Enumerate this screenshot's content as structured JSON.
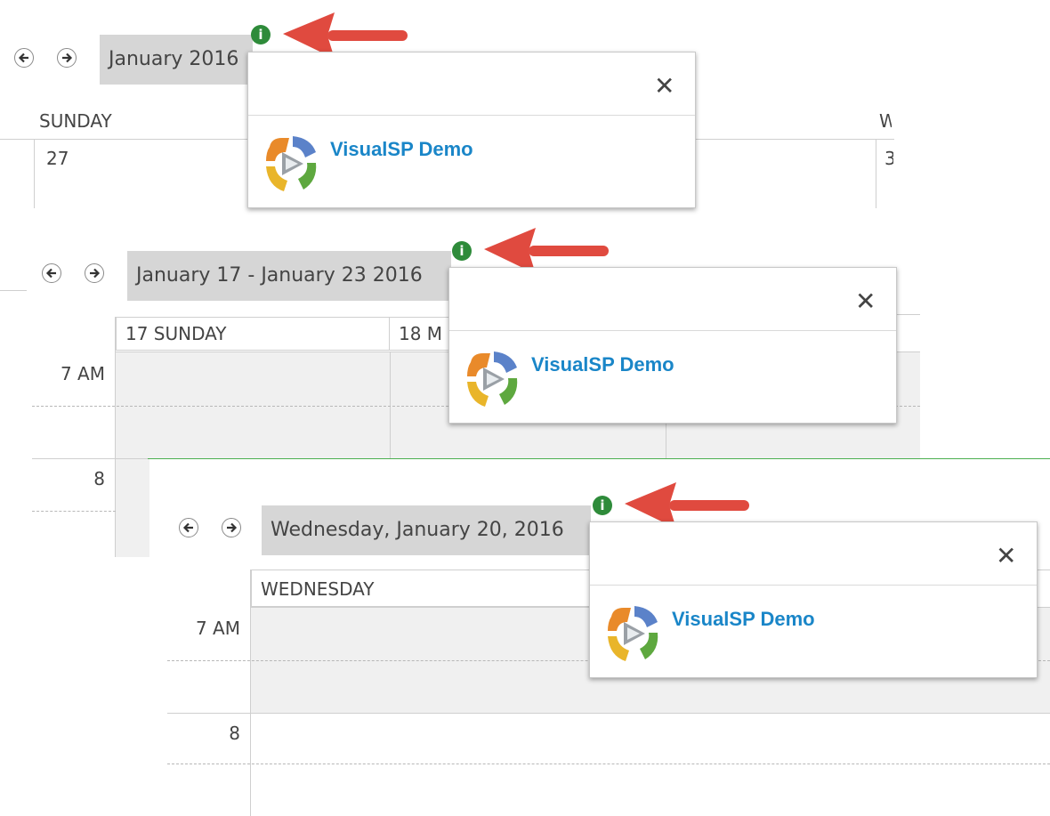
{
  "views": {
    "month": {
      "title": "January 2016",
      "day_header": "SUNDAY",
      "day_header_cut": "W",
      "cell_date": "27",
      "cell_date_cut": "3"
    },
    "week": {
      "title": "January 17 - January 23 2016",
      "columns": [
        "17 SUNDAY",
        "18 M"
      ],
      "time_7": "7 AM",
      "time_8": "8"
    },
    "day": {
      "title": "Wednesday, January 20, 2016",
      "column": "WEDNESDAY",
      "time_7": "7 AM",
      "time_8": "8"
    }
  },
  "popup": {
    "link_text": "VisualSP Demo",
    "close_glyph": "✕",
    "info_glyph": "i"
  },
  "icons": {
    "prev": "arrow-left-icon",
    "next": "arrow-right-icon",
    "info": "info-icon",
    "close": "close-icon",
    "annotation": "red-arrow-icon",
    "logo": "visualsp-logo-icon"
  },
  "colors": {
    "info_green": "#2e8b3a",
    "link_blue": "#1a86c8",
    "arrow_red": "#e04a3f",
    "title_bar": "#d6d6d6",
    "time_line_green": "#4caf50"
  }
}
